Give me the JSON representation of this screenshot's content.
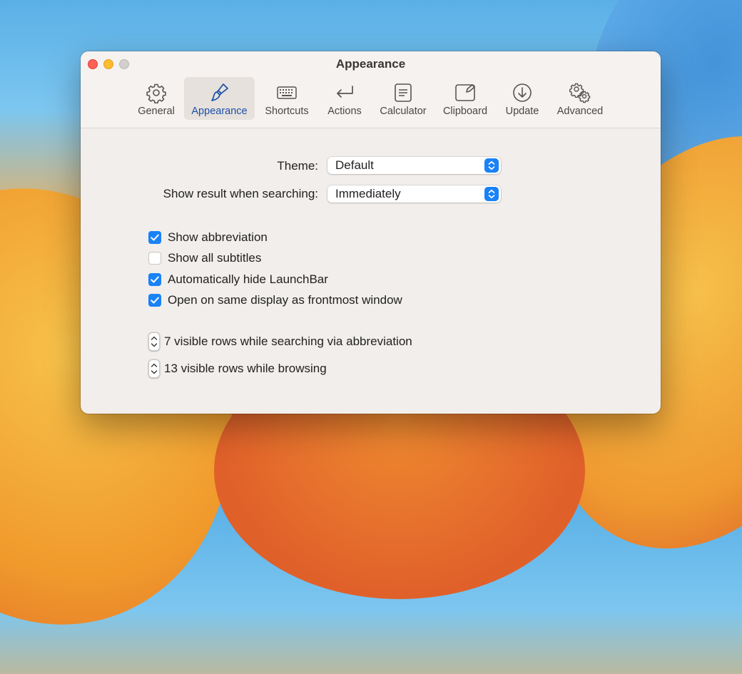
{
  "window": {
    "title": "Appearance"
  },
  "toolbar": {
    "items": [
      {
        "label": "General",
        "icon": "gear-icon",
        "selected": false
      },
      {
        "label": "Appearance",
        "icon": "paintbrush-icon",
        "selected": true
      },
      {
        "label": "Shortcuts",
        "icon": "keyboard-icon",
        "selected": false
      },
      {
        "label": "Actions",
        "icon": "return-arrow-icon",
        "selected": false
      },
      {
        "label": "Calculator",
        "icon": "calculator-icon",
        "selected": false
      },
      {
        "label": "Clipboard",
        "icon": "clipboard-icon",
        "selected": false
      },
      {
        "label": "Update",
        "icon": "download-circle-icon",
        "selected": false
      },
      {
        "label": "Advanced",
        "icon": "gears-icon",
        "selected": false
      }
    ]
  },
  "settings": {
    "theme": {
      "label": "Theme:",
      "value": "Default"
    },
    "show_result": {
      "label": "Show result when searching:",
      "value": "Immediately"
    },
    "checkboxes": [
      {
        "label": "Show abbreviation",
        "checked": true
      },
      {
        "label": "Show all subtitles",
        "checked": false
      },
      {
        "label": "Automatically hide LaunchBar",
        "checked": true
      },
      {
        "label": "Open on same display as frontmost window",
        "checked": true
      }
    ],
    "steppers": [
      {
        "label": "7 visible rows while searching via abbreviation"
      },
      {
        "label": "13 visible rows while browsing"
      }
    ]
  },
  "colors": {
    "accent": "#1a82f7",
    "selected_label": "#1c4fa8"
  }
}
